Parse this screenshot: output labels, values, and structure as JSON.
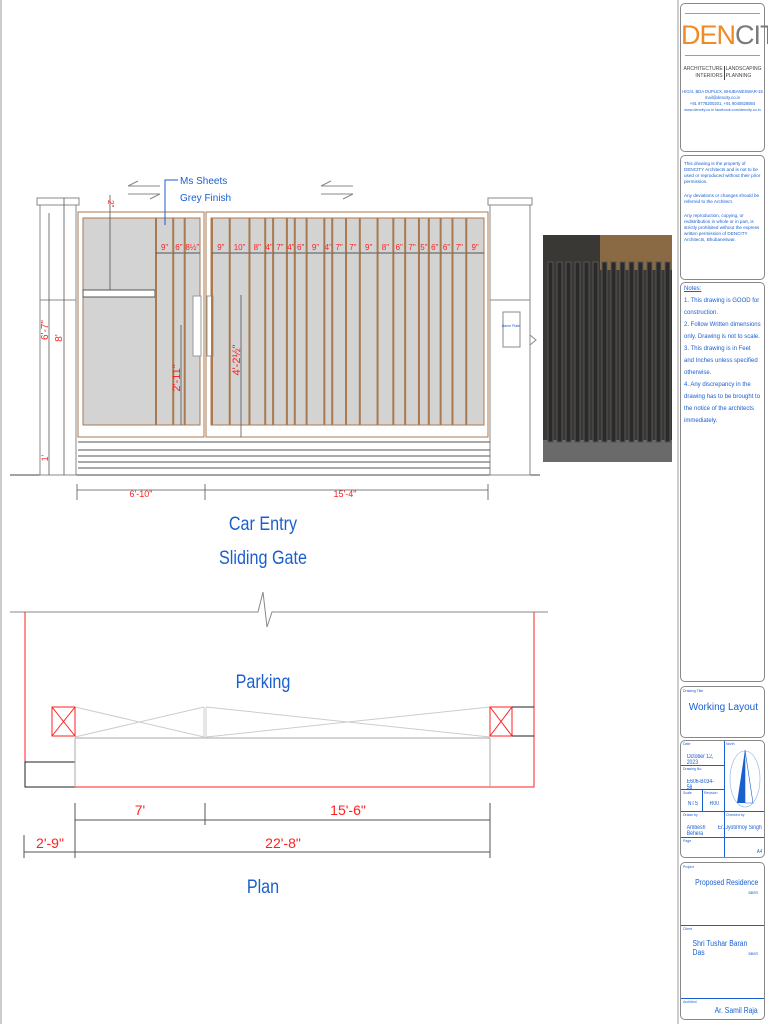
{
  "brand": {
    "name_part1": "DEN",
    "name_part2": "CITY",
    "services_left": "ARCHITECTURE\nINTERIORS",
    "services_right": "LANDSCAPING\nPLANNING",
    "address": "HIG/4, BDA DUPLEX, BHUBANESWAR-15",
    "email": "mail@dencity.co.in",
    "phone": "+91 9778200201, +91 9040828884",
    "web": "www.dencity.co.in facebook.com/dencity.co.in",
    "colors": {
      "orange": "#f08a24",
      "gray": "#7a7a7a"
    }
  },
  "disclaimer": [
    "This drawing is the property of DENCITY Architects and is not to be used or reproduced without their prior permission.",
    "Any deviations or changes should be referred to the Architect.",
    "Any reproduction, copying, or redistribution in whole or in part, is strictly prohibited without the express written permission of DENCITY Architects, Bhubaneswar."
  ],
  "notes": {
    "heading": "Notes:",
    "items": [
      "1. This drawing is GOOD for construction.",
      "2. Follow Written dimensions only. Drawing is not to scale.",
      "3. This drawing is in Feet and Inches unless specified otherwise.",
      "4. Any discrepancy in the drawing has to be brought to the notice of the architects immediately."
    ]
  },
  "drawing_title": {
    "label": "Drawing Title",
    "value": "Working Layout"
  },
  "info": {
    "date_label": "Date",
    "date": "October 12, 2023",
    "drawing_no_label": "Drawing No.",
    "drawing_no": "E606-B034-56",
    "scale_label": "Scale",
    "scale": "NTS",
    "revision_label": "Revision",
    "revision": "R00",
    "north_label": "North",
    "drawn_label": "Drawn by",
    "drawn": "Ambesh Behera",
    "checked_label": "Checked by",
    "checked": "Er. Jyotirmoy Singh",
    "page_label": "Page",
    "page": "A4"
  },
  "project": {
    "label": "Project",
    "value": "Proposed Residence",
    "sub": "BBSR"
  },
  "client": {
    "label": "Client",
    "value": "Shri Tushar Baran Das",
    "sub": "BBSR"
  },
  "architect": {
    "label": "Architect",
    "value": "Ar. Samil Raja"
  },
  "elevation": {
    "material_note_1": "Ms Sheets",
    "material_note_2": "Grey Finish",
    "left_slats": [
      "9\"",
      "6\"",
      "8½\""
    ],
    "right_slats": [
      "9\"",
      "10\"",
      "8\"",
      "4\"",
      "7\"",
      "4\"",
      "6\"",
      "9\"",
      "4\"",
      "7\"",
      "7\"",
      "9\"",
      "8\"",
      "6\"",
      "7\"",
      "5\"",
      "6\"",
      "6\"",
      "7\"",
      "9\""
    ],
    "dim_pillar_height": "6'-7\"",
    "dim_total_height": "8'",
    "dim_base": "1'",
    "dim_top": "2\"",
    "dim_handle": "2'-11\"",
    "dim_handle_right": "4'-2½\"",
    "dim_left_leaf": "6'-10\"",
    "dim_right_leaf": "15'-4\"",
    "name_plate": "Name Plate",
    "title_1": "Car Entry",
    "title_2": "Sliding Gate"
  },
  "plan": {
    "area_label": "Parking",
    "dim_left": "7'",
    "dim_right": "15'-6\"",
    "dim_pillar": "2'-9\"",
    "dim_total": "22'-8\"",
    "title": "Plan"
  },
  "colors": {
    "dim_red": "#ff2020",
    "title_blue": "#1a5fd0",
    "panel_gray": "#d3d3d3",
    "frame_brown": "#a97a50"
  }
}
